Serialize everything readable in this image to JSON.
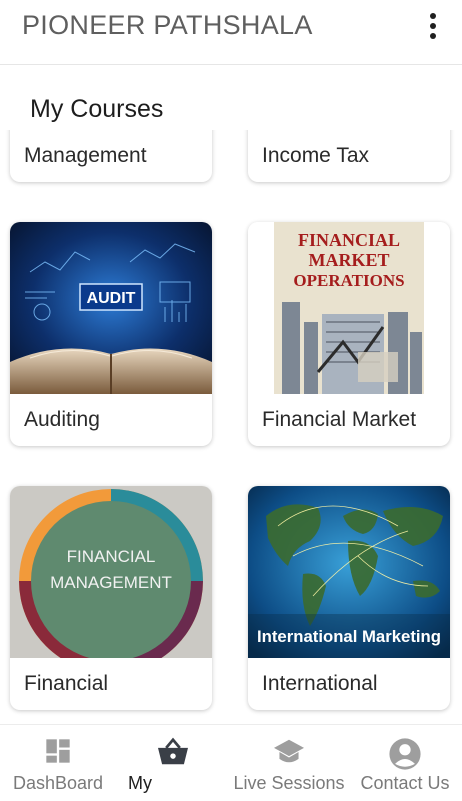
{
  "app": {
    "title": "PIONEER PATHSHALA"
  },
  "section": {
    "title": "My Courses"
  },
  "courses": [
    {
      "label": "Management"
    },
    {
      "label": "Income Tax"
    },
    {
      "label": "Auditing",
      "thumb_text": "AUDIT"
    },
    {
      "label": "Financial Market",
      "thumb_text": [
        "FINANCIAL",
        "MARKET",
        "OPERATIONS"
      ]
    },
    {
      "label": "Financial",
      "thumb_text": [
        "FINANCIAL",
        "MANAGEMENT"
      ]
    },
    {
      "label": "International",
      "thumb_text": "International  Marketing"
    }
  ],
  "nav": [
    {
      "label": "DashBoard",
      "icon": "dashboard-icon"
    },
    {
      "label": "My",
      "icon": "basket-icon",
      "active": true
    },
    {
      "label": "Live Sessions",
      "icon": "graduation-cap-icon"
    },
    {
      "label": "Contact Us",
      "icon": "account-circle-icon"
    }
  ],
  "colors": {
    "nav_icon": "#9e9e9e",
    "nav_active_icon": "#3a3f47",
    "text": "#2a2a2a"
  }
}
